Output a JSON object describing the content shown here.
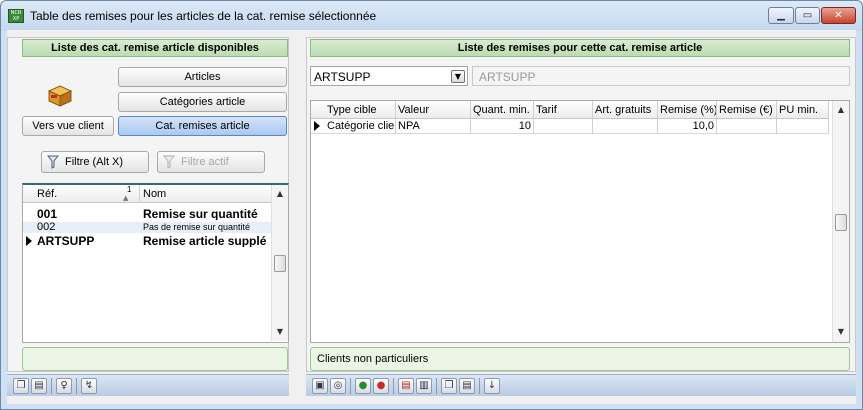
{
  "window": {
    "title": "Table des remises pour les articles de la cat. remise sélectionnée",
    "app_icon_text": [
      "NCR",
      "XP"
    ]
  },
  "left_panel": {
    "header": "Liste des cat. remise article disponibles",
    "buttons": {
      "articles": "Articles",
      "categories_article": "Catégories article",
      "vers_vue_client": "Vers vue client",
      "cat_remises_article": "Cat. remises article",
      "filtre": "Filtre (Alt X)",
      "filtre_actif": "Filtre actif"
    },
    "grid": {
      "columns": [
        "Réf.",
        "Nom"
      ],
      "sort_indicator": "1",
      "rows": [
        {
          "ref": "001",
          "nom": "Remise sur quantité",
          "style": "bold"
        },
        {
          "ref": "002",
          "nom": "Pas de remise sur quantité",
          "style": "small"
        },
        {
          "ref": "ARTSUPP",
          "nom": "Remise article supplémentaire",
          "style": "bold",
          "current": true
        }
      ]
    },
    "status_text": ""
  },
  "right_panel": {
    "header": "Liste des remises pour cette cat. remise article",
    "combo_value": "ARTSUPP",
    "combo_readonly_value": "ARTSUPP",
    "grid": {
      "columns": [
        "Type cible",
        "Valeur",
        "Quant. min.",
        "Tarif",
        "Art. gratuits",
        "Remise (%)",
        "Remise (€)",
        "PU min."
      ],
      "rows": [
        {
          "type_cible": "Catégorie client",
          "valeur": "NPA",
          "quant_min": "10",
          "tarif": "",
          "art_gratuits": "",
          "remise_pct": "10,0",
          "remise_eur": "",
          "pu_min": ""
        }
      ]
    },
    "status_text": "Clients non particuliers"
  },
  "colors": {
    "panel_header_green": "#bcdcb0",
    "active_button_blue": "#a9c9f0",
    "close_button_red": "#c8432e"
  }
}
